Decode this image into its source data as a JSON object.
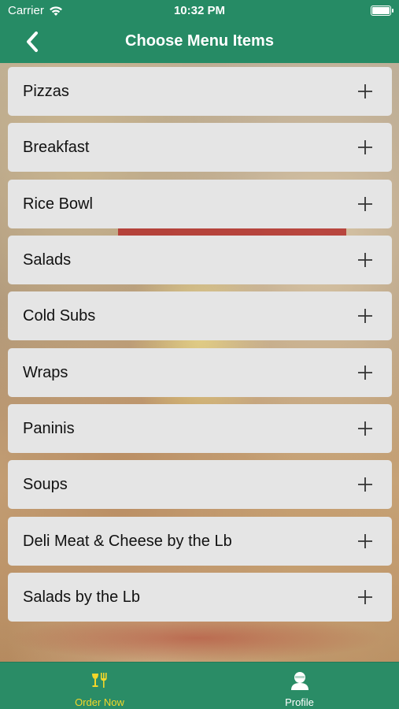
{
  "status_bar": {
    "carrier": "Carrier",
    "time": "10:32 PM"
  },
  "nav": {
    "title": "Choose Menu Items"
  },
  "menu": {
    "items": [
      {
        "label": "Pizzas"
      },
      {
        "label": "Breakfast"
      },
      {
        "label": "Rice Bowl"
      },
      {
        "label": "Salads"
      },
      {
        "label": "Cold Subs"
      },
      {
        "label": "Wraps"
      },
      {
        "label": "Paninis"
      },
      {
        "label": "Soups"
      },
      {
        "label": "Deli Meat & Cheese by the Lb"
      },
      {
        "label": "Salads by the Lb"
      }
    ]
  },
  "tab_bar": {
    "tabs": [
      {
        "label": "Order Now",
        "icon": "restaurant-icon",
        "active": true
      },
      {
        "label": "Profile",
        "icon": "profile-icon",
        "active": false
      }
    ]
  },
  "colors": {
    "brand_green": "#2a8c66",
    "active_tab": "#f3d72a",
    "item_background": "#e5e5e5"
  }
}
